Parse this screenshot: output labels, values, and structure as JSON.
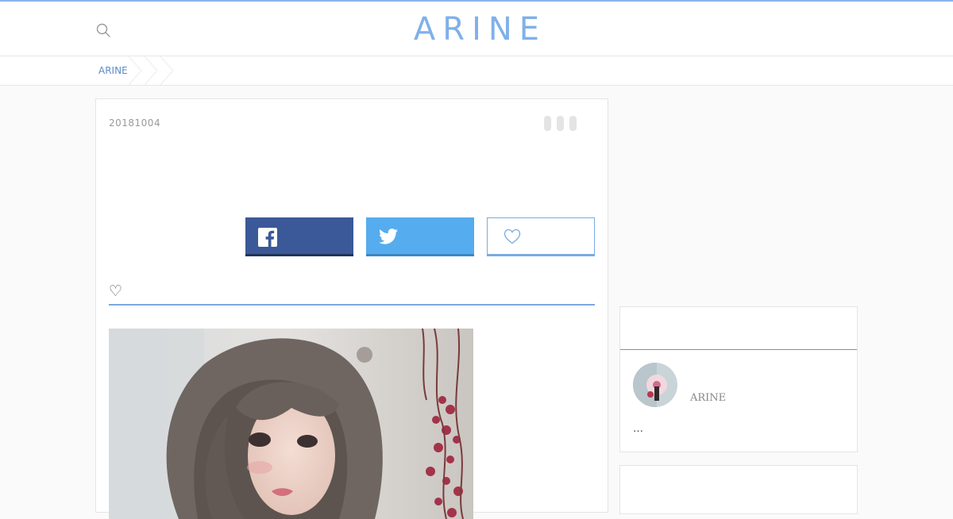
{
  "brand": {
    "logo_text": "ARINE",
    "accent_color": "#7fb0ea"
  },
  "header": {
    "search_icon": "search-icon"
  },
  "breadcrumb": {
    "items": [
      "ARINE"
    ]
  },
  "article": {
    "date": "20181004",
    "menu_icon": "dots-icon",
    "share": {
      "facebook_icon": "facebook-icon",
      "twitter_icon": "twitter-icon",
      "like_icon": "heart-icon",
      "facebook_color": "#3b5998",
      "twitter_color": "#55acee"
    },
    "section_title": "♡"
  },
  "sidebar": {
    "author": {
      "name": "ARINE",
      "description": "…"
    }
  }
}
